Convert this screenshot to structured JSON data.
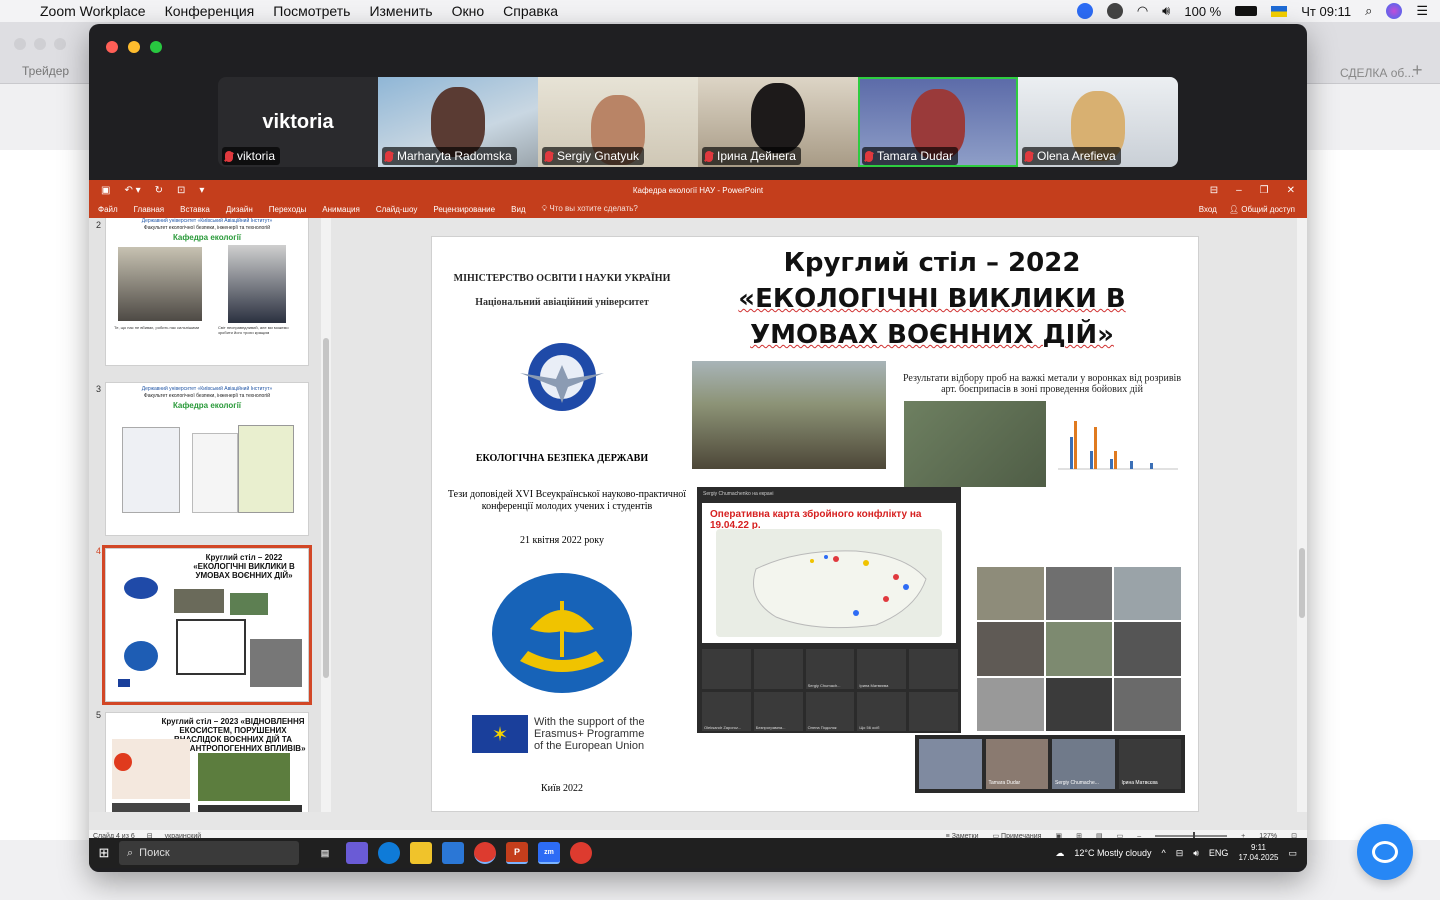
{
  "menubar": {
    "app": "Zoom Workplace",
    "items": [
      "Конференция",
      "Посмотреть",
      "Изменить",
      "Окно",
      "Справка"
    ],
    "battery": "100 %",
    "clock": "Чт 09:11"
  },
  "background_browser": {
    "left_tab": "Трейдер",
    "right_tab": "СДЕЛКА об..."
  },
  "gallery": {
    "tiles": [
      {
        "name": "viktoria",
        "big_name": "viktoria",
        "video": false
      },
      {
        "name": "Marharyta Radomska",
        "video": true
      },
      {
        "name": "Sergiy Gnatyuk",
        "video": true
      },
      {
        "name": "Ірина Дейнега",
        "video": true
      },
      {
        "name": "Tamara Dudar",
        "video": true,
        "active": true
      },
      {
        "name": "Olena Arefieva",
        "video": true
      }
    ]
  },
  "ppt": {
    "doc_title": "Кафедра екології НАУ - PowerPoint",
    "ribbon_tabs": [
      "Файл",
      "Главная",
      "Вставка",
      "Дизайн",
      "Переходы",
      "Анимация",
      "Слайд-шоу",
      "Рецензирование",
      "Вид"
    ],
    "tell_me": "Что вы хотите сделать?",
    "signin": "Вход",
    "share": "Общий доступ",
    "thumbnails": {
      "slide2": {
        "num": "2",
        "uni": "Державний університет «Київський Авіаційний Інститут»",
        "fac": "Факультет екологічної безпеки, інженерії та технологій",
        "dept": "Кафедра екології",
        "cap1": "Те, що нас не вбиває, робить нас сильнішими",
        "cap2": "Світ несправедливий, але ми можемо зробити його трохи кращим"
      },
      "slide3": {
        "num": "3",
        "uni": "Державний університет «Київський Авіаційний Інститут»",
        "fac": "Факультет екологічної безпеки, інженерії та технологій",
        "dept": "Кафедра екології"
      },
      "slide4": {
        "num": "4",
        "title": "Круглий стіл – 2022 «ЕКОЛОГІЧНІ ВИКЛИКИ В УМОВАХ ВОЄННИХ ДІЙ»"
      },
      "slide5": {
        "num": "5",
        "title": "Круглий стіл – 2023 «ВІДНОВЛЕННЯ ЕКОСИСТЕМ, ПОРУШЕНИХ ВНАСЛІДОК ВОЄННИХ ДІЙ ТА ІНШИХ АНТРОПОГЕННИХ ВПЛИВІВ»"
      }
    },
    "slide": {
      "ministry": "МІНІСТЕРСТВО ОСВІТИ І НАУКИ УКРАЇНИ",
      "university": "Національний авіаційний університет",
      "title_line1": "Круглий стіл – 2022",
      "title_line2": "«ЕКОЛОГІЧНІ ВИКЛИКИ В",
      "title_line3": "УМОВАХ ВОЄННИХ ДІЙ»",
      "eco_security": "ЕКОЛОГІЧНА БЕЗПЕКА ДЕРЖАВИ",
      "tezy": "Тези доповідей XVI Всеукраїнської науково-практичної конференції молодих учених і студентів",
      "date": "21 квітня 2022 року",
      "erasmus": "With the support of the Erasmus+ Programme of the European Union",
      "city": "Київ 2022",
      "results": "Результати відбору проб на важкі метали у воронках від розривів арт. боєприпасів в зоні проведення бойових дій",
      "map_header": "Sergiy Chumachenko на екрані",
      "map_title": "Оперативна карта збройного конфлікту на 19.04.22 р.",
      "map_tiles": [
        "",
        "",
        "Sergiy Chumach...",
        "Ірина Матвєєва",
        "",
        "Oleksandr Zaporoz...",
        "Безпрограмна...",
        "Олена Подоляк",
        "Що 56 осіб",
        ""
      ],
      "bottom_gallery": [
        "",
        "Tamara Dudar",
        "Sergiy Chumache...",
        "Ірина Матвєєва"
      ]
    },
    "status": {
      "slide": "Слайд 4 из 6",
      "lang": "украинский",
      "notes": "Заметки",
      "comments": "Примечания",
      "zoom": "127%"
    }
  },
  "taskbar": {
    "search": "Поиск",
    "weather": "12°C  Mostly cloudy",
    "lang": "ENG",
    "time": "9:11",
    "date": "17.04.2025"
  },
  "colors": {
    "ppt_accent": "#c43e1c",
    "active_speaker": "#2ecc40",
    "chat_fab": "#2787f5"
  }
}
